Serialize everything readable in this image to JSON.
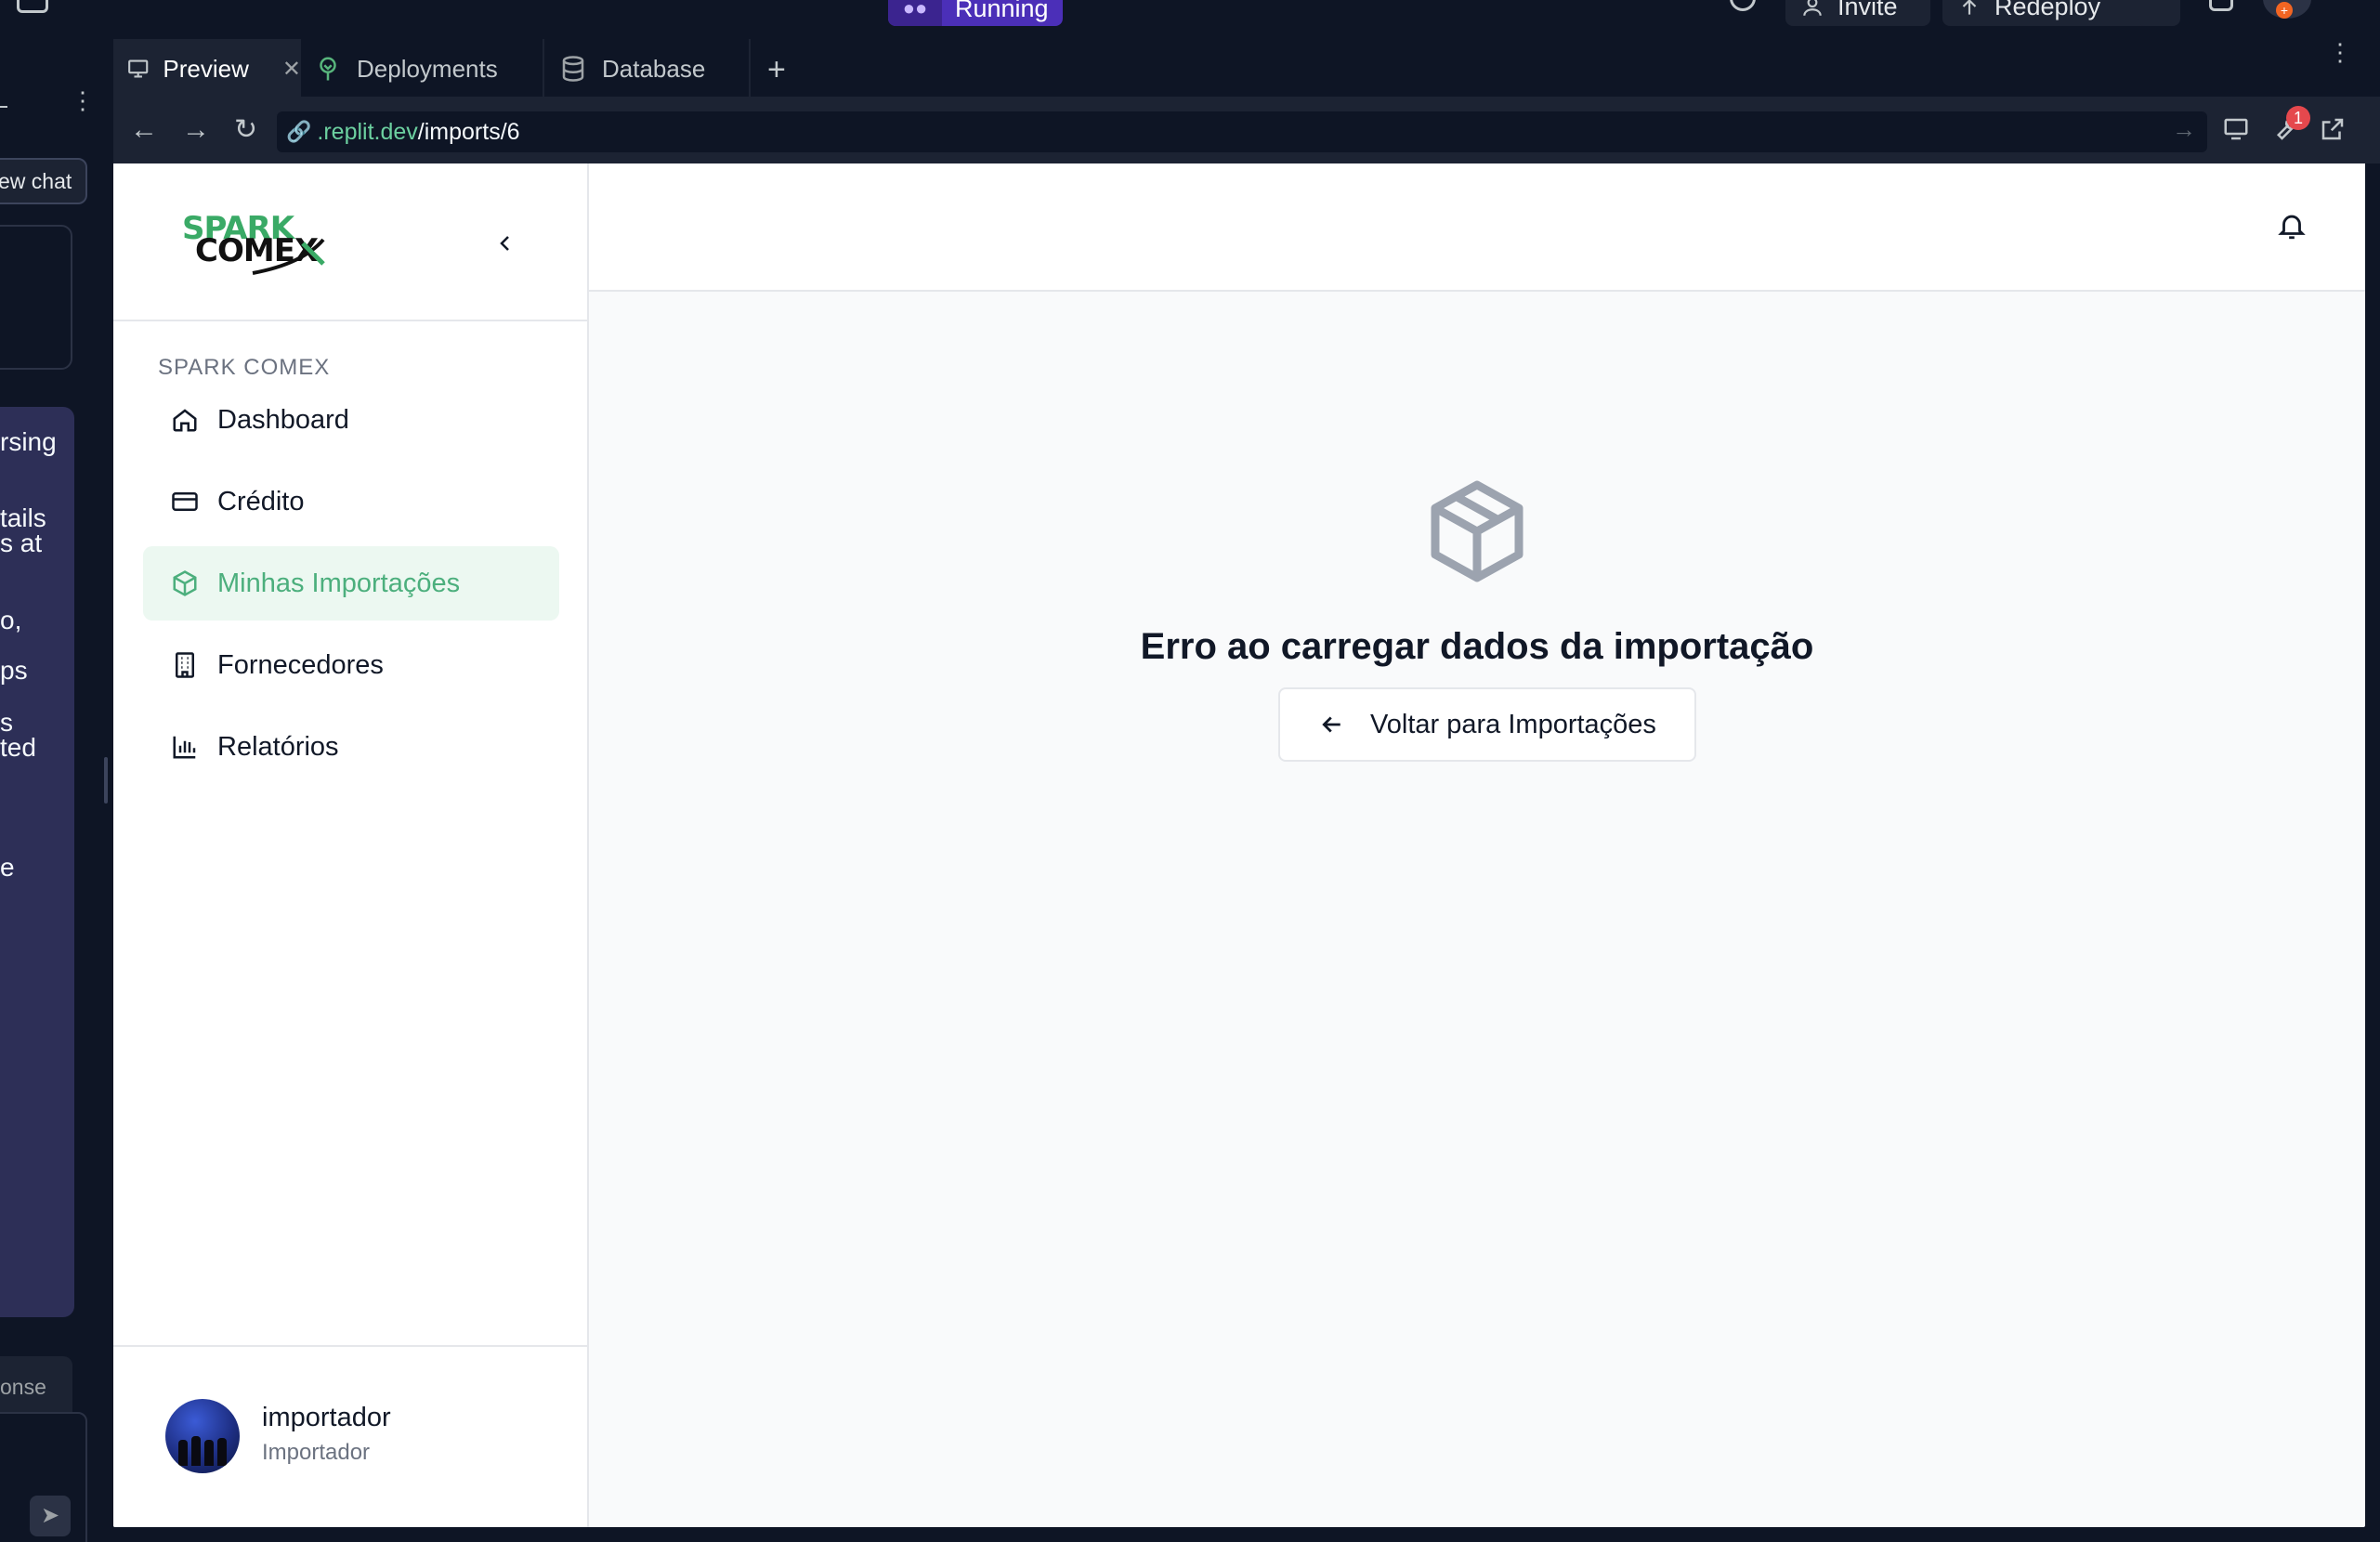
{
  "replit": {
    "status_label": "Running",
    "invite_label": "Invite",
    "redeploy_label": "Redeploy",
    "notification_count": "1"
  },
  "chat_panel": {
    "new_chat_label": "ew chat",
    "fragments": [
      "rsing",
      "tails",
      "s at",
      "o,",
      "ps",
      "s",
      "ted",
      "e"
    ],
    "response_placeholder": "onse"
  },
  "tabs": [
    {
      "label": "Preview",
      "icon": "monitor-icon"
    },
    {
      "label": "Deployments",
      "icon": "deploy-tree-icon"
    },
    {
      "label": "Database",
      "icon": "database-icon"
    }
  ],
  "url": {
    "host": ".replit.dev",
    "path": "/imports/6"
  },
  "devtools_badge": "1",
  "app": {
    "brand_line1": "SPARK",
    "brand_line2": "COMEX",
    "section_title": "SPARK COMEX",
    "nav": [
      {
        "label": "Dashboard",
        "icon": "home-icon",
        "active": false
      },
      {
        "label": "Crédito",
        "icon": "credit-card-icon",
        "active": false
      },
      {
        "label": "Minhas Importações",
        "icon": "package-icon",
        "active": true
      },
      {
        "label": "Fornecedores",
        "icon": "building-icon",
        "active": false
      },
      {
        "label": "Relatórios",
        "icon": "bar-chart-icon",
        "active": false
      }
    ],
    "user": {
      "name": "importador",
      "role": "Importador"
    },
    "error_title": "Erro ao carregar dados da importação",
    "back_button_label": "Voltar para Importações"
  },
  "colors": {
    "accent_green": "#4caf7d",
    "active_bg": "#ecf8f1",
    "replit_bg": "#0e1525",
    "running_purple": "#4b2fb8"
  }
}
